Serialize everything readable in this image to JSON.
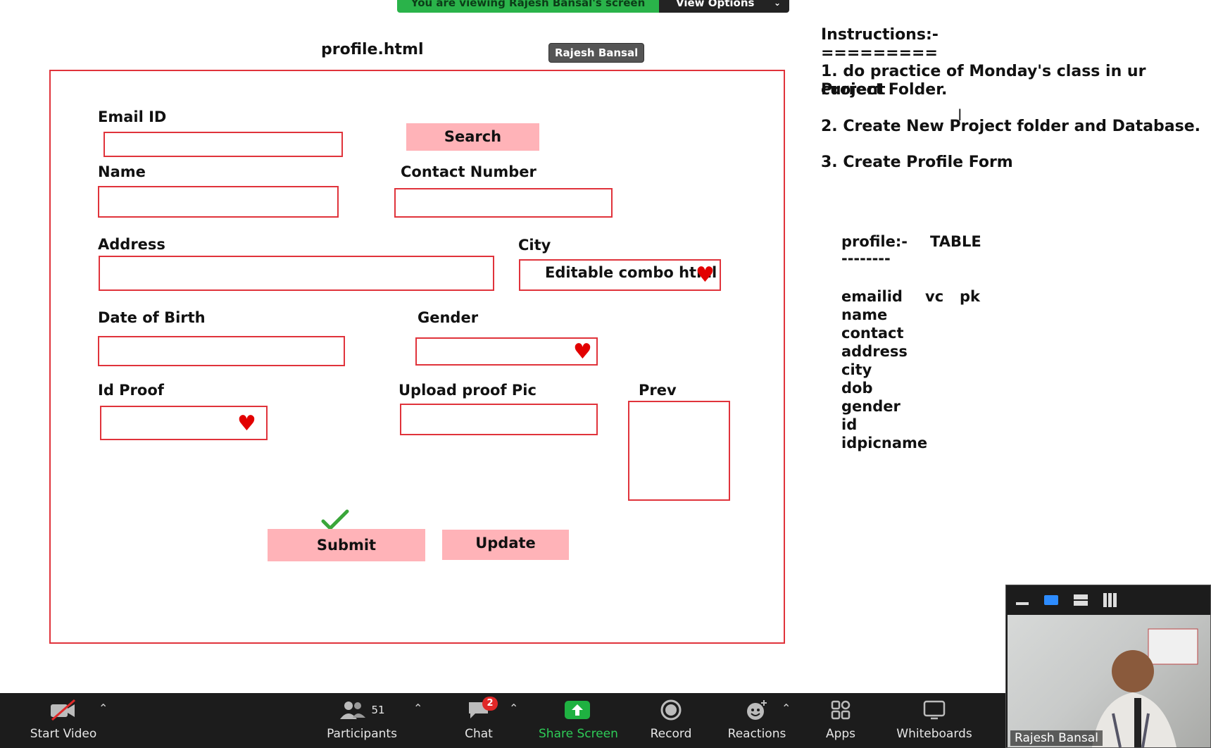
{
  "banner": {
    "message": "You are viewing Rajesh Bansal's screen",
    "options_label": "View Options",
    "chevron": "chevron-down-icon"
  },
  "page_file": "profile.html",
  "presenter_tag": "Rajesh Bansal",
  "form": {
    "email_label": "Email ID",
    "search_label": "Search",
    "name_label": "Name",
    "contact_label": "Contact Number",
    "address_label": "Address",
    "city_label": "City",
    "city_value": "Editable combo html",
    "dob_label": "Date of Birth",
    "gender_label": "Gender",
    "idproof_label": "Id Proof",
    "upload_label": "Upload proof Pic",
    "prev_label": "Prev",
    "submit_label": "Submit",
    "update_label": "Update"
  },
  "instructions": {
    "title": "Instructions:-",
    "underline": "=========",
    "step1a": "1. do practice of Monday's class in ur current",
    "step1b": "Project Folder.",
    "step2": "2. Create New Project folder and Database.",
    "step3": "3. Create Profile Form"
  },
  "schema": {
    "title": "profile:-",
    "kind": "TABLE",
    "dashes": "--------",
    "fields": [
      "emailid",
      "name",
      "contact",
      "address",
      "city",
      "dob",
      "gender",
      "id",
      "idpicname"
    ],
    "type": "vc",
    "key": "pk"
  },
  "toolbar": {
    "start_video": "Start Video",
    "participants": "Participants",
    "participants_count": "51",
    "chat": "Chat",
    "chat_badge": "2",
    "share_screen": "Share Screen",
    "record": "Record",
    "reactions": "Reactions",
    "apps": "Apps",
    "whiteboards": "Whiteboards"
  },
  "video": {
    "participant_name": "Rajesh Bansal"
  },
  "colors": {
    "form_border": "#e0333b",
    "button_fill": "#ffb3b8",
    "heart": "#e20000",
    "share_green": "#2ab34a",
    "toolbar_bg": "#1c1c1c"
  }
}
